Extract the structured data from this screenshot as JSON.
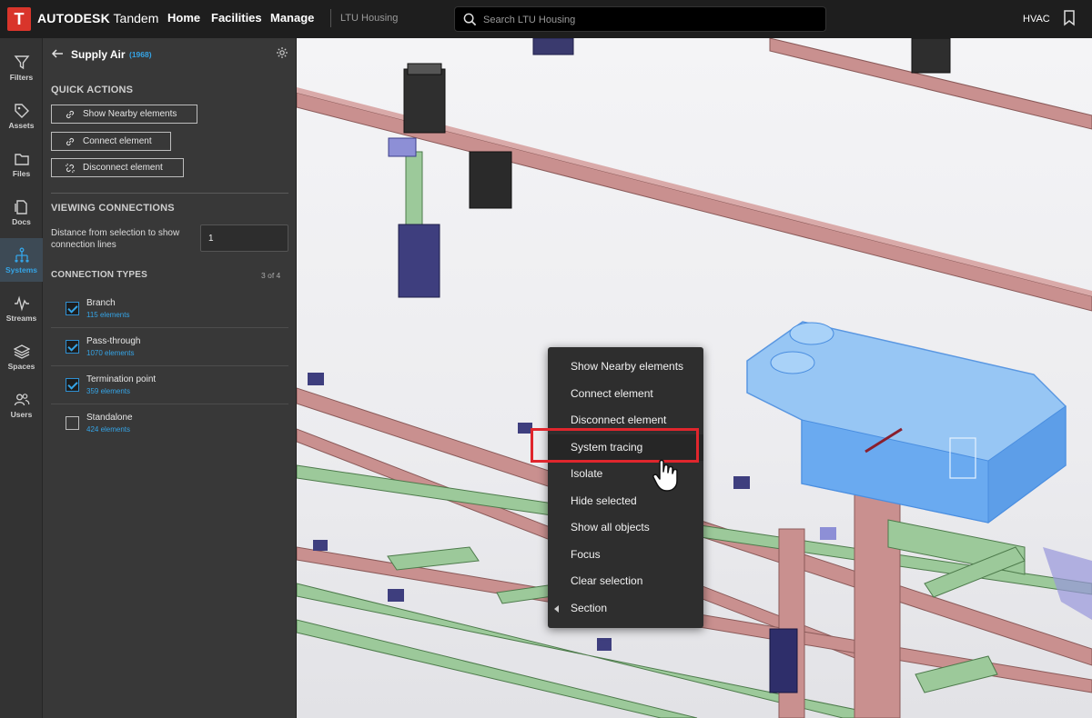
{
  "app": {
    "logo_letter": "T",
    "brand": "AUTODESK",
    "product": "Tandem",
    "nav": [
      "Home",
      "Facilities",
      "Manage"
    ],
    "facility": "LTU Housing",
    "search_placeholder": "Search LTU Housing",
    "view_mode": "HVAC"
  },
  "rail": [
    {
      "label": "Filters",
      "icon": "filter-icon"
    },
    {
      "label": "Assets",
      "icon": "tag-icon"
    },
    {
      "label": "Files",
      "icon": "folder-icon"
    },
    {
      "label": "Docs",
      "icon": "docs-icon"
    },
    {
      "label": "Systems",
      "icon": "systems-icon",
      "active": true
    },
    {
      "label": "Streams",
      "icon": "streams-icon"
    },
    {
      "label": "Spaces",
      "icon": "spaces-icon"
    },
    {
      "label": "Users",
      "icon": "users-icon"
    }
  ],
  "panel": {
    "title": "Supply Air",
    "count": "(1968)",
    "quick_actions_heading": "QUICK ACTIONS",
    "quick_actions": [
      "Show Nearby elements",
      "Connect element",
      "Disconnect element"
    ],
    "viewing_heading": "VIEWING CONNECTIONS",
    "distance_label": "Distance from selection to show connection lines",
    "distance_value": "1",
    "types_heading": "CONNECTION TYPES",
    "types_count": "3 of 4",
    "types": [
      {
        "name": "Branch",
        "count": "115 elements",
        "checked": true
      },
      {
        "name": "Pass-through",
        "count": "1070 elements",
        "checked": true
      },
      {
        "name": "Termination point",
        "count": "359 elements",
        "checked": true
      },
      {
        "name": "Standalone",
        "count": "424 elements",
        "checked": false
      }
    ]
  },
  "context_menu": {
    "items": [
      "Show Nearby elements",
      "Connect element",
      "Disconnect element",
      "System tracing",
      "Isolate",
      "Hide selected",
      "Show all objects",
      "Focus",
      "Clear selection",
      "Section"
    ],
    "highlighted": "System tracing"
  },
  "colors": {
    "accent": "#35a4e6",
    "highlight_box": "#e0262d",
    "duct_red": "#c9908f",
    "duct_green": "#9cc99a",
    "selection_blue": "#7fb6f0"
  }
}
